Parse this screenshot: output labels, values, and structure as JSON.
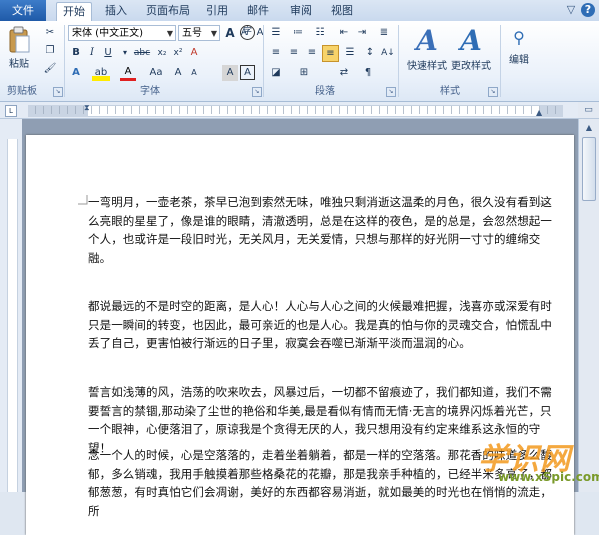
{
  "tabs": {
    "file": "文件",
    "items": [
      "开始",
      "插入",
      "页面布局",
      "引用",
      "邮件",
      "审阅",
      "视图"
    ],
    "active": "开始"
  },
  "window_controls": {
    "minimize": "▽",
    "help": "?"
  },
  "ribbon": {
    "clipboard": {
      "paste": "粘贴",
      "label": "剪贴板"
    },
    "font": {
      "font_name": "宋体 (中文正文)",
      "font_size": "五号",
      "grow": "A",
      "shrink": "A",
      "label": "字体",
      "bold": "B",
      "italic": "I",
      "underline": "U",
      "strike": "abc",
      "sub": "x₂",
      "sup": "x²",
      "text_effect": "A",
      "highlight": "ab",
      "font_color": "A",
      "change_case": "Aa",
      "char_border": "A",
      "char_shading": "A",
      "phonetic": "A",
      "clear": "A",
      "enclose": "字"
    },
    "paragraph": {
      "label": "段落"
    },
    "styles": {
      "quick": "快速样式",
      "change": "更改样式",
      "label": "样式"
    },
    "editing": {
      "label": "编辑"
    }
  },
  "document": {
    "paragraphs": [
      "一弯明月，一壶老茶，茶早已泡到索然无味，唯独只剩消逝这温柔的月色，很久没有看到这么亮眼的星星了，像是谁的眼睛，清澈透明，总是在这样的夜色，是的总是，会忽然想起一个人，也或许是一段旧时光，无关风月，无关爱情，只想与那样的好光阴一寸寸的缠绵交融。",
      "都说最远的不是时空的距离，是人心！人心与人心之间的火候最难把握，浅喜亦或深爱有时只是一瞬间的转变，也因此，最可亲近的也是人心。我是真的怕与你的灵魂交合，怕慌乱中丢了自己，更害怕被行渐远的日子里，寂寞会吞噬已渐渐平淡而温润的心。",
      "誓言如浅薄的风，浩荡的吹来吹去，风暴过后，一切都不留痕迹了，我们都知道，我们不需要誓言的禁锢,那动染了尘世的艳俗和华美,最是看似有情而无情·无言的境界闪烁着光芒，只一个眼神，心便落泪了，原谅我是个贪得无厌的人，我只想用没有约定来维系这永恒的守望！",
      "念一个人的时候，心是空落落的，走着坐着躺着，都是一样的空落落。那花香的味道多么馥郁，多么销魂，我用手触摸着那些格桑花的花瓣，那是我亲手种植的，已经半米多高了，都郁葱葱，有时真怕它们会凋谢，美好的东西都容易消逝，就如最美的时光也在悄悄的流走，所"
    ]
  },
  "watermark": {
    "logo": "学识网",
    "site": "www.xSpic.com"
  }
}
